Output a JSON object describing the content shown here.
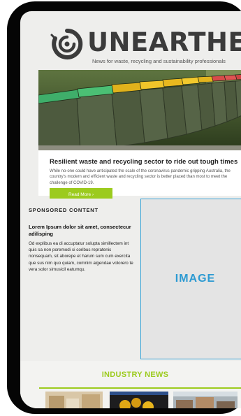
{
  "brand": {
    "name": "UNEARTHED",
    "tagline": "News for waste, recycling and sustainability professionals"
  },
  "feature": {
    "title": "Resilient waste and recycling sector to ride out tough times",
    "summary": "While no-one could have anticipated the scale of the coronavirus pandemic gripping Australia, the country's modern and efficient waste and recycling sector is better placed than most to meet the challenge of COVID-19.",
    "button_label": "Read More ›"
  },
  "sponsored": {
    "label": "SPONSORED CONTENT",
    "heading": "Lorem Ipsum dolor sit amet, consectecur adilisping",
    "body": "Od explibus ea di accuptatur solupta simillectem int quis sa non poremodi si coribus repratenis nonsequam, sit aborepe et harum sum cum exercita que sus nim quo quiam, comnim algendae volorero te vera solor simusicil eatumqu.",
    "image_placeholder": "IMAGE"
  },
  "industry_news": {
    "heading": "INDUSTRY NEWS"
  },
  "colors": {
    "accent_green": "#9ccb1e",
    "placeholder_blue": "#3ba3d6",
    "phone_frame": "#050505",
    "background": "#eeeeec"
  }
}
